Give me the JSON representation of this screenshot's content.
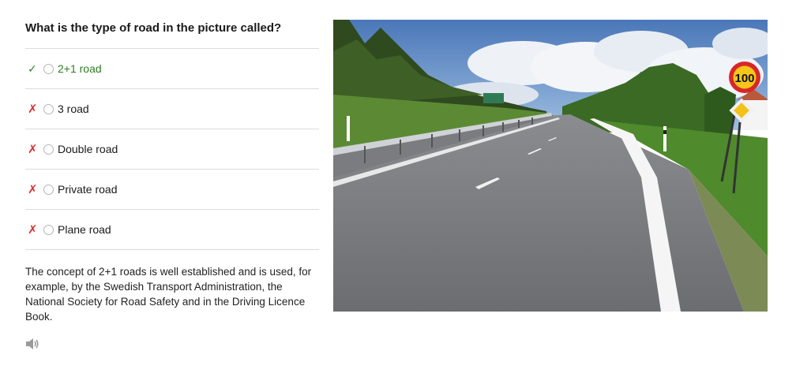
{
  "question": {
    "title": "What is the type of road in the picture called?",
    "options": [
      {
        "mark": "✓",
        "status": "correct",
        "label": "2+1 road"
      },
      {
        "mark": "✗",
        "status": "wrong",
        "label": "3 road"
      },
      {
        "mark": "✗",
        "status": "wrong",
        "label": "Double road"
      },
      {
        "mark": "✗",
        "status": "wrong",
        "label": "Private road"
      },
      {
        "mark": "✗",
        "status": "wrong",
        "label": "Plane road"
      }
    ],
    "explanation": "The concept of 2+1 roads is well established and is used, for example, by the Swedish Transport Administration, the National Society for Road Safety and in the Driving Licence Book."
  },
  "photo": {
    "speed_sign_text": "100"
  },
  "audio": {
    "icon": "speaker-icon"
  },
  "colors": {
    "correct": "#2e7d1f",
    "wrong": "#e03030",
    "divider": "#dcdcdc"
  }
}
